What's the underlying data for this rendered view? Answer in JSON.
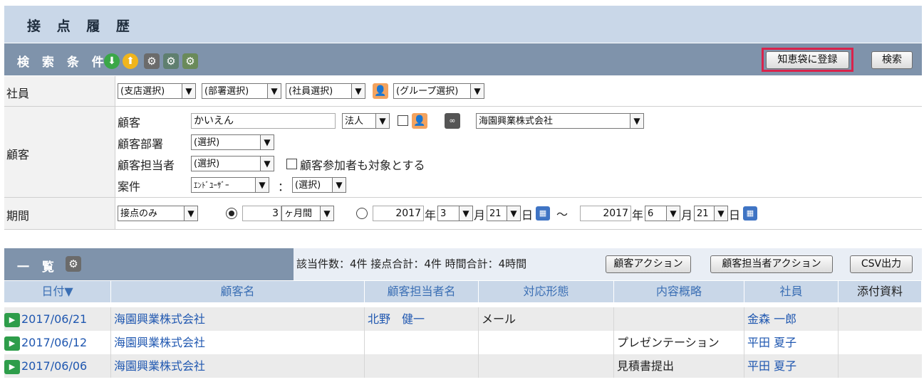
{
  "page_title": "接 点 履 歴",
  "search": {
    "label": "検 索 条 件",
    "register_button": "知恵袋に登録",
    "search_button": "検索",
    "icons": [
      "down-arrow-icon",
      "up-arrow-icon",
      "gear-icon",
      "gear-search-icon",
      "gear-edit-icon"
    ]
  },
  "employee": {
    "label": "社員",
    "branch": "(支店選択)",
    "dept": "(部署選択)",
    "staff": "(社員選択)",
    "group": "(グループ選択)"
  },
  "customer": {
    "label": "顧客",
    "name_label": "顧客",
    "name_value": "かいえん",
    "corp_type": "法人",
    "company": "海園興業株式会社",
    "dept_label": "顧客部署",
    "dept_value": "(選択)",
    "contact_label": "顧客担当者",
    "contact_value": "(選択)",
    "include_participants": "顧客参加者も対象とする",
    "case_label": "案件",
    "case_type": "ｴﾝﾄﾞﾕｰｻﾞｰ",
    "colon": "：",
    "case_value": "(選択)"
  },
  "period": {
    "label": "期間",
    "mode": "接点のみ",
    "months_value": "3",
    "months_unit": "ヶ月間",
    "from_year": "2017",
    "from_month": "3",
    "from_day": "21",
    "to_year": "2017",
    "to_month": "6",
    "to_day": "21",
    "year_char": "年",
    "month_char": "月",
    "day_char": "日",
    "tilde": "～"
  },
  "list": {
    "label": "一 覧",
    "summary": "該当件数：4件 接点合計：4件 時間合計：4時間",
    "btn_customer_action": "顧客アクション",
    "btn_contact_action": "顧客担当者アクション",
    "btn_csv": "CSV出力",
    "columns": [
      "日付▼",
      "顧客名",
      "顧客担当者名",
      "対応形態",
      "内容概略",
      "社員",
      "添付資料"
    ],
    "rows": [
      {
        "date": "2017/06/21",
        "customer": "海園興業株式会社",
        "contact": "北野　健一",
        "type": "メール",
        "summary": "",
        "staff": "金森 一郎",
        "attach": ""
      },
      {
        "date": "2017/06/12",
        "customer": "海園興業株式会社",
        "contact": "",
        "type": "",
        "summary": "プレゼンテーション",
        "staff": "平田 夏子",
        "attach": ""
      },
      {
        "date": "2017/06/06",
        "customer": "海園興業株式会社",
        "contact": "",
        "type": "",
        "summary": "見積書提出",
        "staff": "平田 夏子",
        "attach": ""
      }
    ]
  },
  "colors": {
    "header_bar": "#7f93ab",
    "title_bg": "#c9d7e8",
    "highlight": "#d9234b",
    "link": "#1f57b0"
  }
}
